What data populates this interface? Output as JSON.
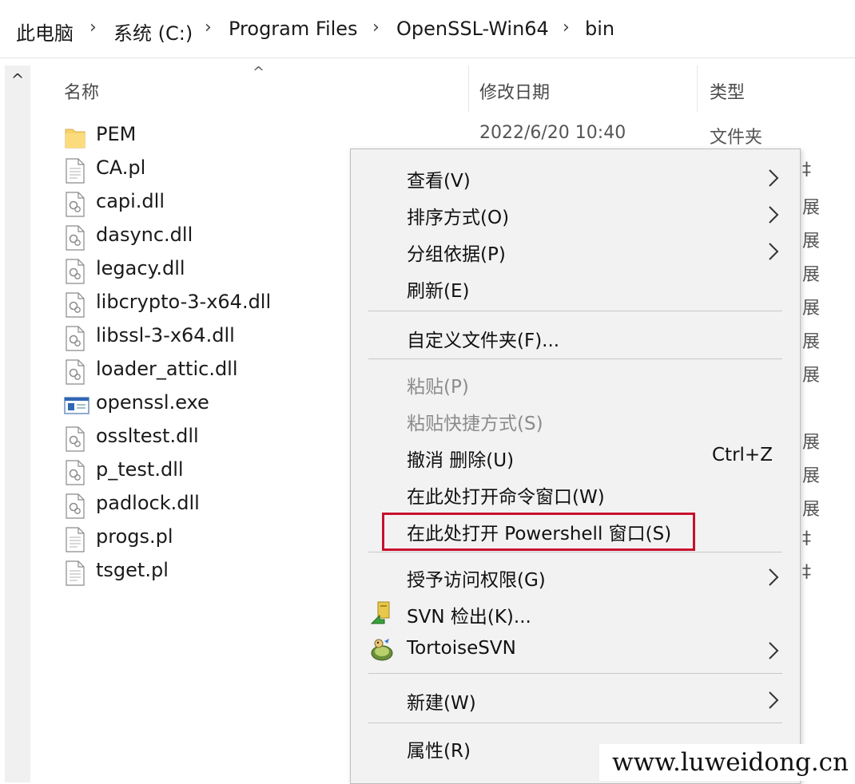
{
  "breadcrumb": {
    "items": [
      "此电脑",
      "系统 (C:)",
      "Program Files",
      "OpenSSL-Win64",
      "bin"
    ],
    "separator": "›"
  },
  "scrollbar": {
    "up_arrow": "^"
  },
  "columns": {
    "name": "名称",
    "date": "修改日期",
    "type": "类型",
    "sort_indicator": "^"
  },
  "files": [
    {
      "name": "PEM",
      "icon": "folder-icon",
      "date": "2022/6/20 10:40",
      "type": "文件夹"
    },
    {
      "name": "CA.pl",
      "icon": "text-file-icon"
    },
    {
      "name": "capi.dll",
      "icon": "dll-file-icon"
    },
    {
      "name": "dasync.dll",
      "icon": "dll-file-icon"
    },
    {
      "name": "legacy.dll",
      "icon": "dll-file-icon"
    },
    {
      "name": "libcrypto-3-x64.dll",
      "icon": "dll-file-icon"
    },
    {
      "name": "libssl-3-x64.dll",
      "icon": "dll-file-icon"
    },
    {
      "name": "loader_attic.dll",
      "icon": "dll-file-icon"
    },
    {
      "name": "openssl.exe",
      "icon": "exe-file-icon"
    },
    {
      "name": "ossltest.dll",
      "icon": "dll-file-icon"
    },
    {
      "name": "p_test.dll",
      "icon": "dll-file-icon"
    },
    {
      "name": "padlock.dll",
      "icon": "dll-file-icon"
    },
    {
      "name": "progs.pl",
      "icon": "text-file-icon"
    },
    {
      "name": "tsget.pl",
      "icon": "text-file-icon"
    }
  ],
  "type_peek": [
    "‡",
    "展",
    "展",
    "展",
    "展",
    "展",
    "展",
    "展",
    "展",
    "展",
    "‡",
    "‡"
  ],
  "context_menu": {
    "items": [
      {
        "label": "查看(V)",
        "submenu": true
      },
      {
        "label": "排序方式(O)",
        "submenu": true
      },
      {
        "label": "分组依据(P)",
        "submenu": true
      },
      {
        "label": "刷新(E)"
      },
      {
        "label": "自定义文件夹(F)..."
      },
      {
        "label": "粘贴(P)",
        "disabled": true
      },
      {
        "label": "粘贴快捷方式(S)",
        "disabled": true
      },
      {
        "label": "撤消 删除(U)",
        "shortcut": "Ctrl+Z"
      },
      {
        "label": "在此处打开命令窗口(W)"
      },
      {
        "label": "在此处打开 Powershell 窗口(S)",
        "highlighted": true
      },
      {
        "label": "授予访问权限(G)",
        "submenu": true
      },
      {
        "label": "SVN 检出(K)...",
        "icon": "svn-checkout-icon"
      },
      {
        "label": "TortoiseSVN",
        "icon": "tortoisesvn-icon",
        "submenu": true
      },
      {
        "label": "新建(W)",
        "submenu": true
      },
      {
        "label": "属性(R)"
      }
    ]
  },
  "watermark": "www.luweidong.cn",
  "colors": {
    "highlight_border": "#c8102e",
    "menu_bg": "#f2f2f2",
    "folder": "#f6d26b"
  }
}
